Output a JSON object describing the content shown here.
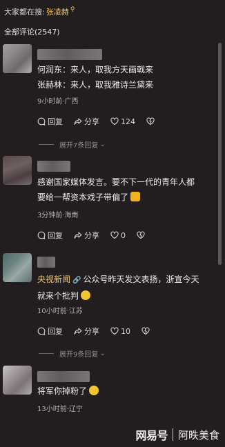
{
  "search": {
    "prefix": "大家都在搜:",
    "keyword": "张凌赫"
  },
  "comments_count_label": "全部评论(2547)",
  "comments": [
    {
      "lines": [
        "何润东：来人，取我方天画戟来",
        "张赫林：来人，取我雅诗兰黛来"
      ],
      "meta": "9小时前·广西",
      "reply": "回复",
      "share": "分享",
      "likes": "124",
      "expand": "展开7条回复"
    },
    {
      "lines": [
        "感谢国家媒体发言。要不下一代的青年人都",
        "要给一帮资本戏子带偏了"
      ],
      "meta": "3分钟前·海南",
      "reply": "回复",
      "share": "分享",
      "likes": "0"
    },
    {
      "tag": "央视新闻",
      "lines": [
        "公众号昨天发文表扬，浙宣今天",
        "就来个批判"
      ],
      "meta": "10小时前·江苏",
      "reply": "回复",
      "share": "分享",
      "likes": "10",
      "expand": "展开9条回复"
    },
    {
      "lines": [
        "将军你掉粉了"
      ],
      "meta": "13小时前·辽宁"
    }
  ],
  "watermark": {
    "brand": "网易号",
    "author": "阿昳美食"
  },
  "colors": {
    "background": "#221d1f",
    "accent": "#f0c76a",
    "meta": "#b8b2b4"
  }
}
